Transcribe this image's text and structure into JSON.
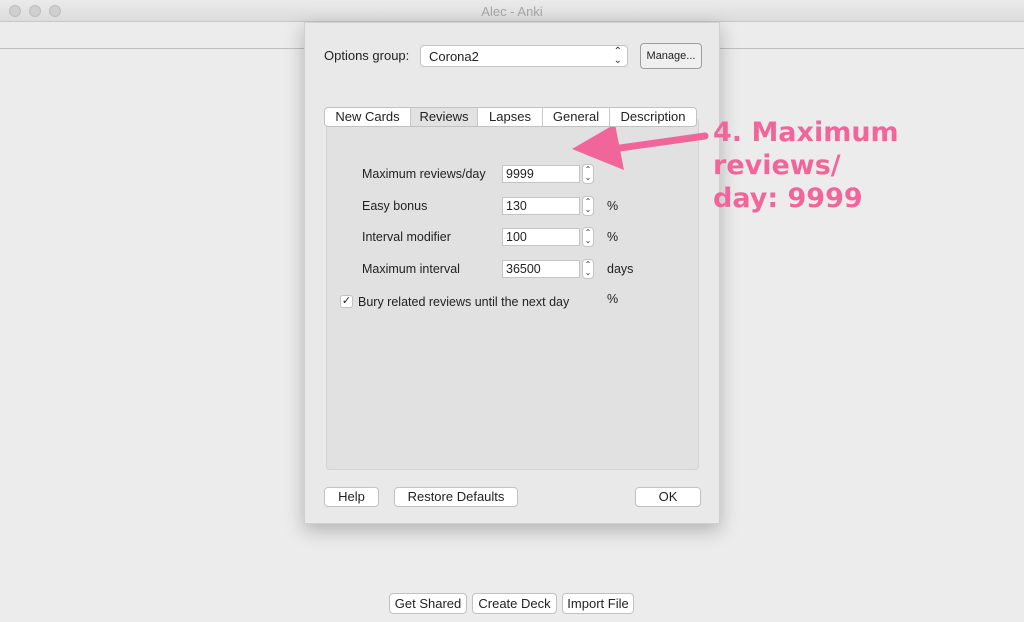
{
  "window": {
    "title": "Alec - Anki"
  },
  "dialog": {
    "options_group_label": "Options group:",
    "options_group_value": "Corona2",
    "manage_label": "Manage...",
    "tabs": [
      {
        "label": "New Cards",
        "active": false
      },
      {
        "label": "Reviews",
        "active": true
      },
      {
        "label": "Lapses",
        "active": false
      },
      {
        "label": "General",
        "active": false
      },
      {
        "label": "Description",
        "active": false
      }
    ],
    "fields": [
      {
        "label": "Maximum reviews/day",
        "value": "9999",
        "unit": ""
      },
      {
        "label": "Easy bonus",
        "value": "130",
        "unit": "%"
      },
      {
        "label": "Interval modifier",
        "value": "100",
        "unit": "%"
      },
      {
        "label": "Maximum interval",
        "value": "36500",
        "unit": "days"
      }
    ],
    "extra_unit": "%",
    "bury_checkbox": {
      "label": "Bury related reviews until the next day",
      "checked": true,
      "mark": "✓"
    },
    "help_label": "Help",
    "restore_label": "Restore Defaults",
    "ok_label": "OK"
  },
  "bottom_bar": {
    "get_shared": "Get Shared",
    "create_deck": "Create Deck",
    "import_file": "Import File"
  },
  "annotation": {
    "line1": "4. Maximum reviews/",
    "line2": "day: 9999",
    "color": "#f1669a"
  }
}
